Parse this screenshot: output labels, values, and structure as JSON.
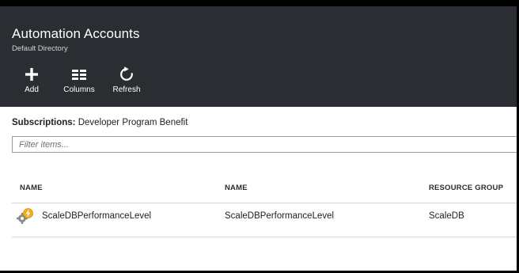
{
  "header": {
    "title": "Automation Accounts",
    "subtitle": "Default Directory",
    "background": "#2a2d31"
  },
  "toolbar": {
    "items": [
      {
        "label": "Add",
        "icon": "plus-icon"
      },
      {
        "label": "Columns",
        "icon": "columns-icon"
      },
      {
        "label": "Refresh",
        "icon": "refresh-icon"
      }
    ]
  },
  "subscription": {
    "label": "Subscriptions:",
    "value": "Developer Program Benefit"
  },
  "filter": {
    "placeholder": "Filter items...",
    "value": ""
  },
  "table": {
    "columns": [
      "NAME",
      "NAME",
      "RESOURCE GROUP"
    ],
    "rows": [
      {
        "icon": "automation-account-icon",
        "name": "ScaleDBPerformanceLevel",
        "name2": "ScaleDBPerformanceLevel",
        "resource_group": "ScaleDB"
      }
    ]
  }
}
